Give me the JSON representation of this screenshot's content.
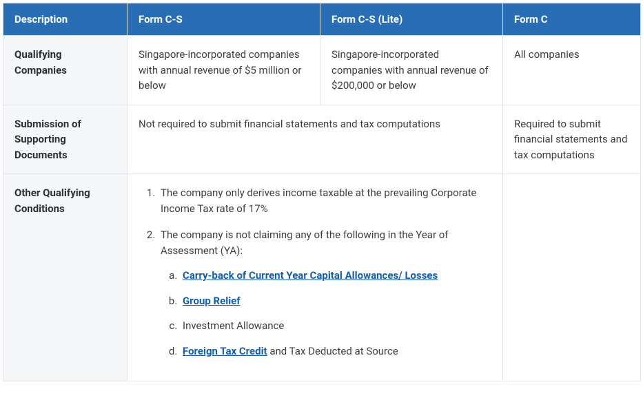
{
  "headers": {
    "c0": "Description",
    "c1": "Form C-S",
    "c2": "Form C-S (Lite)",
    "c3": "Form C"
  },
  "rows": {
    "r1": {
      "label": "Qualifying Companies",
      "c1": "Singapore-incorporated companies with annual revenue of $5 million or below",
      "c2": "Singapore-incorporated companies with annual revenue of $200,000 or below",
      "c3": "All companies"
    },
    "r2": {
      "label": "Submission of Supporting Documents",
      "merged": "Not required to submit financial statements and tax computations",
      "c3": "Required to submit financial statements and tax computations"
    },
    "r3": {
      "label": "Other Qualifying Conditions",
      "item1": "The company only derives income taxable at the prevailing Corporate Income Tax rate of 17%",
      "item2_lead": "The company is not claiming any of the following in the Year of Assessment (YA):",
      "sub_a": "Carry-back of Current Year Capital Allowances/ Losses",
      "sub_b": "Group Relief",
      "sub_c": "Investment Allowance",
      "sub_d_link": "Foreign Tax Credit",
      "sub_d_tail": " and Tax Deducted at Source",
      "c3": ""
    }
  }
}
